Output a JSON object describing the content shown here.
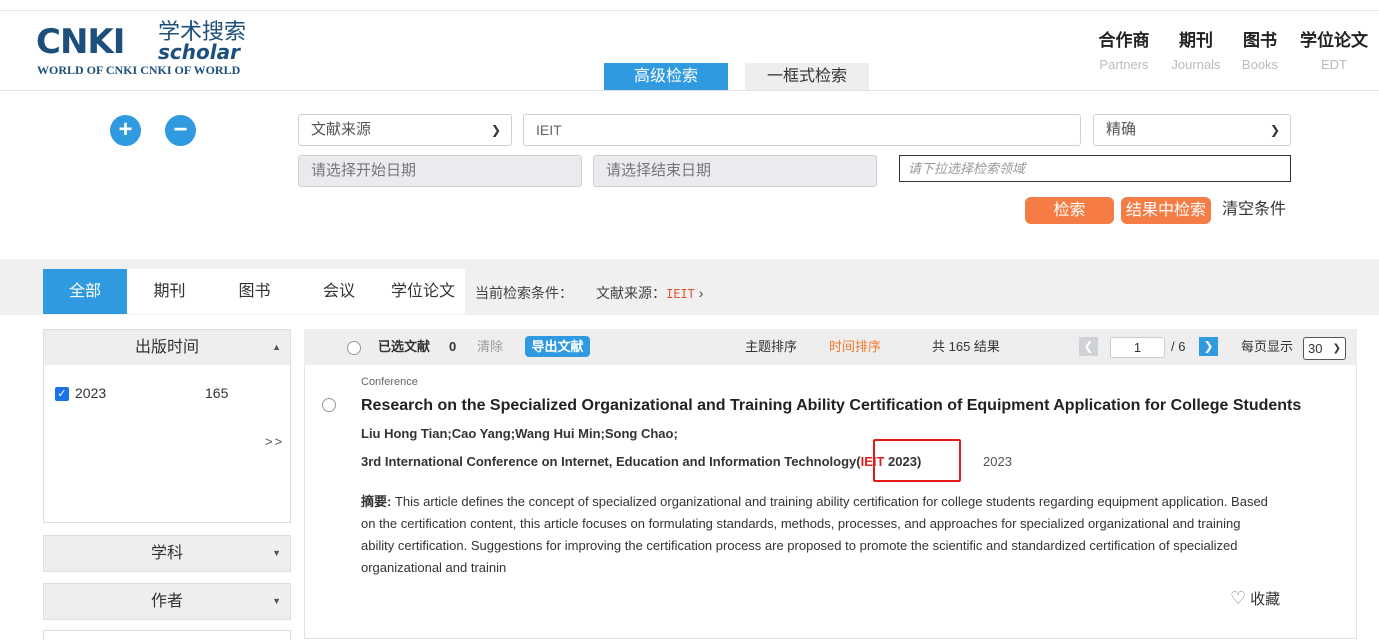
{
  "header": {
    "logo": {
      "mark": "CNKI",
      "mark_cn": "学术搜索",
      "mark_en": "scholar",
      "tagline": "WORLD OF CNKI CNKI OF WORLD"
    },
    "mode_tabs": [
      "高级检索",
      "一框式检索"
    ],
    "nav": [
      {
        "cn": "合作商",
        "en": "Partners"
      },
      {
        "cn": "期刊",
        "en": "Journals"
      },
      {
        "cn": "图书",
        "en": "Books"
      },
      {
        "cn": "学位论文",
        "en": "EDT"
      }
    ]
  },
  "search": {
    "plus": "+",
    "minus": "−",
    "field_select": "文献来源",
    "query": "IEIT",
    "match_select": "精确",
    "start_date_placeholder": "请选择开始日期",
    "end_date_placeholder": "请选择结束日期",
    "domain_placeholder": "请下拉选择检索领域",
    "search_button": "检索",
    "search_in_results_button": "结果中检索",
    "clear_conditions": "清空条件"
  },
  "doc_tabs": [
    "全部",
    "期刊",
    "图书",
    "会议",
    "学位论文"
  ],
  "current_condition": {
    "label": "当前检索条件：",
    "field": "文献来源：",
    "value": "IEIT",
    "chevron": "›"
  },
  "facets": {
    "pub_time": {
      "title": "出版时间",
      "items": [
        {
          "year": "2023",
          "count": "165",
          "checked": true
        }
      ],
      "more": ">>"
    },
    "subject": {
      "title": "学科"
    },
    "author": {
      "title": "作者"
    }
  },
  "results_bar": {
    "selected_label": "已选文献",
    "selected_count": "0",
    "clear": "清除",
    "export": "导出文献",
    "sort_topic": "主题排序",
    "sort_time": "时间排序",
    "total": "共 165 结果",
    "page_current": "1",
    "page_total": "/ 6",
    "per_page_label": "每页显示",
    "per_page_value": "30"
  },
  "result": {
    "type": "Conference",
    "title": "Research on the Specialized Organizational and Training Ability Certification of Equipment Application for College Students",
    "authors": "Liu Hong Tian;Cao Yang;Wang Hui Min;Song Chao;",
    "source": "3rd International Conference on Internet, Education and Information Technology",
    "source_open": "(",
    "source_abbr": "IEIT",
    "source_close": " 2023)",
    "year": "2023",
    "abstract_label": "摘要:",
    "abstract": " This article defines the concept of specialized organizational and training ability certification for college students regarding equipment application. Based on the certification content, this article focuses on formulating standards, methods, processes, and approaches for specialized organizational and training ability certification. Suggestions for improving the certification process are proposed to promote the scientific and standardized certification of specialized organizational and trainin",
    "favorite": "收藏"
  },
  "colors": {
    "accent": "#2f9ae0",
    "orange": "#f57c45",
    "highlight": "#e01b1b"
  },
  "icons": [
    "plus-icon",
    "minus-icon",
    "chevron-down-icon",
    "checkbox-icon",
    "heart-icon",
    "chevron-left-icon",
    "chevron-right-icon"
  ]
}
